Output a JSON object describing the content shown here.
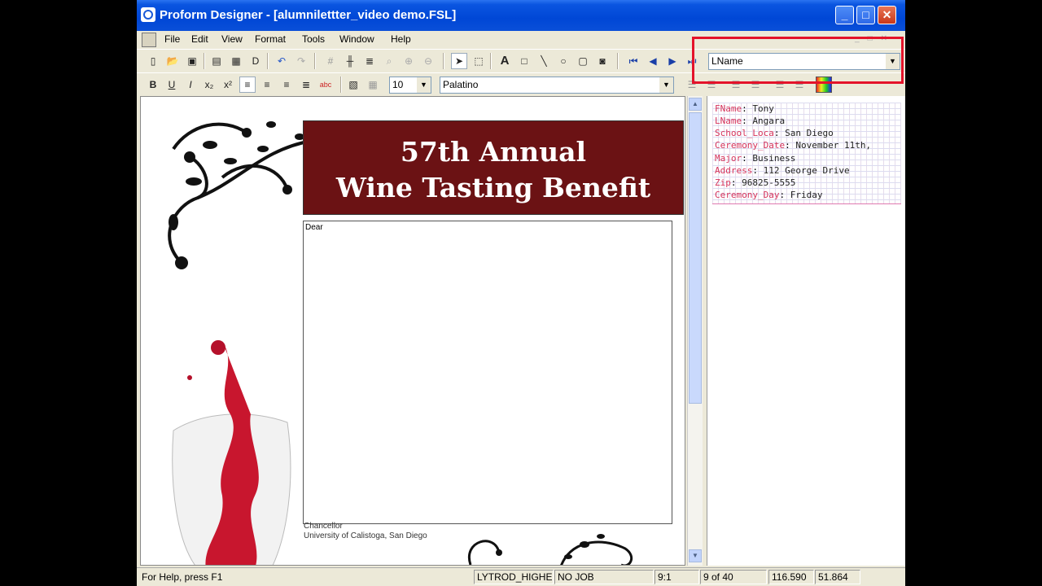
{
  "window": {
    "title": "Proform Designer - [alumnilettter_video demo.FSL]"
  },
  "menu": [
    "File",
    "Edit",
    "View",
    "Format",
    "Tools",
    "Window",
    "Help"
  ],
  "toolbar": {
    "field_combo_value": "LName",
    "font_size": "10",
    "font_name": "Palatino"
  },
  "document": {
    "banner_line1": "57th Annual",
    "banner_line2": "Wine Tasting Benefit",
    "salutation": "Dear",
    "sig_title": "Chancellor",
    "sig_org": "University of Calistoga, San Diego"
  },
  "data_fields": [
    {
      "key": "FName",
      "value": "Tony"
    },
    {
      "key": "LName",
      "value": "Angara"
    },
    {
      "key": "School_Loca",
      "value": "San Diego"
    },
    {
      "key": "Ceremony_Date",
      "value": "November 11th,"
    },
    {
      "key": "Major",
      "value": "Business"
    },
    {
      "key": "Address",
      "value": "112 George Drive"
    },
    {
      "key": "Zip",
      "value": "96825-5555"
    },
    {
      "key": "Ceremony_Day",
      "value": "Friday"
    }
  ],
  "status": {
    "help": "For Help, press F1",
    "printer": "LYTROD_HIGHE",
    "job": "NO JOB",
    "zoom": "9:1",
    "page": "9 of 40",
    "coord_x": "116.590",
    "coord_y": "51.864"
  },
  "colors": {
    "banner": "#6b1214",
    "highlight": "#e4132a",
    "field_key": "#d6335a"
  }
}
